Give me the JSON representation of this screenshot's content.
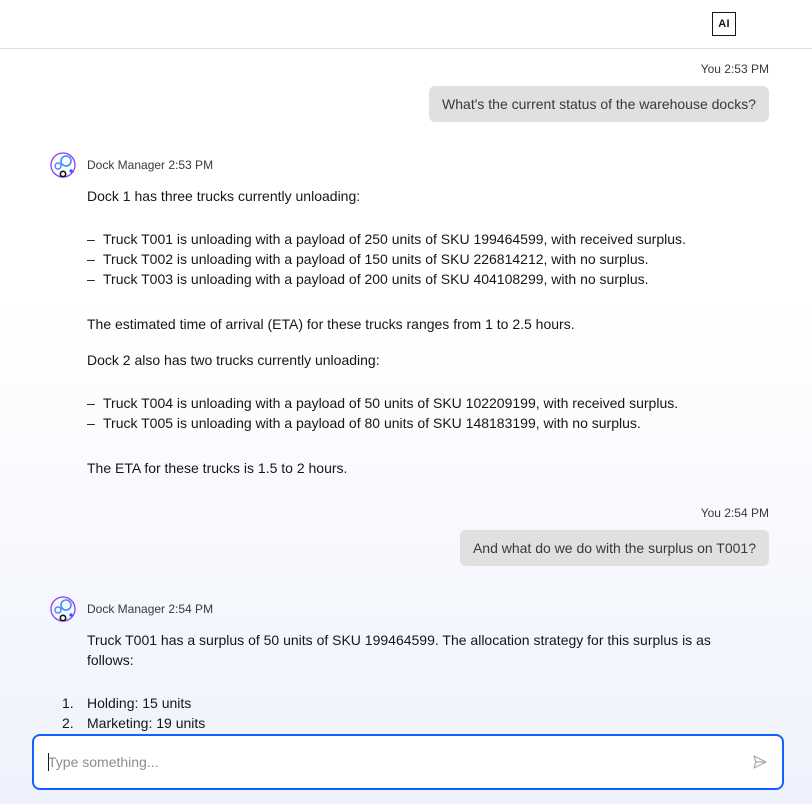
{
  "header": {
    "badge": "AI"
  },
  "messages": [
    {
      "role": "user",
      "meta": "You 2:53 PM",
      "text": "What's the current status of the warehouse docks?"
    },
    {
      "role": "bot",
      "meta": "Dock Manager 2:53 PM",
      "intro": "Dock 1 has three trucks currently unloading:",
      "bullets1": [
        "Truck T001 is unloading with a payload of 250 units of SKU 199464599, with received surplus.",
        "Truck T002 is unloading with a payload of 150 units of SKU 226814212, with no surplus.",
        "Truck T003 is unloading with a payload of 200 units of SKU 404108299, with no surplus."
      ],
      "eta1": "The estimated time of arrival (ETA) for these trucks ranges from 1 to 2.5 hours.",
      "dock2": "Dock 2 also has two trucks currently unloading:",
      "bullets2": [
        "Truck T004 is unloading with a payload of 50 units of SKU 102209199, with received surplus.",
        "Truck T005 is unloading with a payload of 80 units of SKU 148183199, with no surplus."
      ],
      "eta2": "The ETA for these trucks is 1.5 to 2 hours."
    },
    {
      "role": "user",
      "meta": "You 2:54 PM",
      "text": "And what do we do with the surplus on T001?"
    },
    {
      "role": "bot",
      "meta": "Dock Manager 2:54 PM",
      "line1": "Truck T001 has a surplus of 50 units of SKU 199464599. The allocation strategy for this surplus is as",
      "line2": "follows:",
      "list": [
        {
          "num": "1.",
          "text": "Holding: 15 units"
        },
        {
          "num": "2.",
          "text": "Marketing: 19 units"
        }
      ]
    }
  ],
  "input": {
    "placeholder": "Type something...",
    "value": ""
  },
  "icons": {
    "send": "send-icon",
    "avatar": "dock-manager-avatar-icon"
  },
  "colors": {
    "accent": "#0f62fe",
    "user_bubble": "#e0e0e0",
    "avatar_primary": "#4589ff",
    "avatar_secondary": "#8a3ffc"
  }
}
